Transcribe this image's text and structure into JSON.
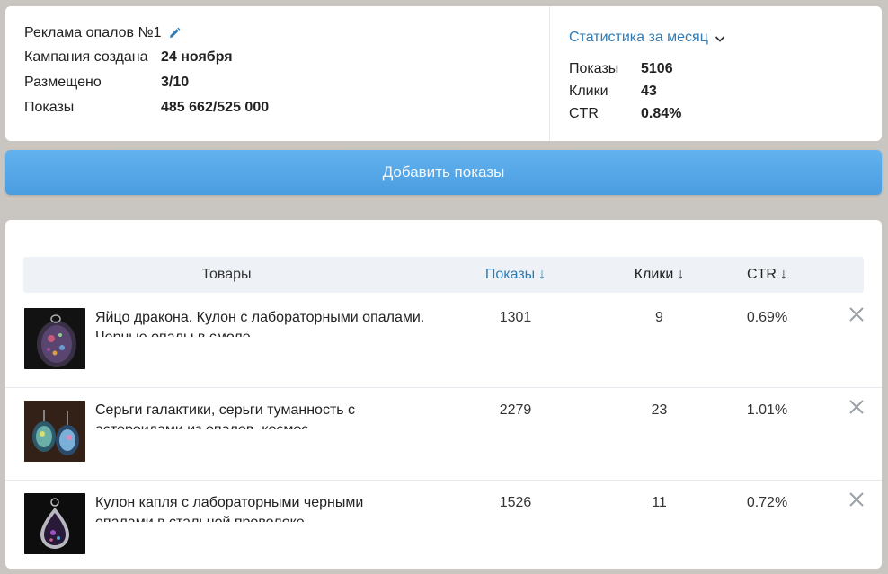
{
  "campaign": {
    "title": "Реклама опалов №1",
    "created_label": "Кампания создана",
    "created_value": "24 ноября",
    "placed_label": "Размещено",
    "placed_value": "3/10",
    "shows_label": "Показы",
    "shows_value": "485 662/525 000"
  },
  "monthly_stats": {
    "toggle_label": "Статистика за месяц",
    "shows_label": "Показы",
    "shows_value": "5106",
    "clicks_label": "Клики",
    "clicks_value": "43",
    "ctr_label": "CTR",
    "ctr_value": "0.84%"
  },
  "add_button_label": "Добавить показы",
  "table": {
    "headers": {
      "products": "Товары",
      "shows": "Показы",
      "clicks": "Клики",
      "ctr": "CTR",
      "sort_arrow": "↓"
    },
    "rows": [
      {
        "title_line1": "Яйцо дракона. Кулон с лабораторными опалами.",
        "title_line2": "Черные опалы в смоле",
        "shows": "1301",
        "clicks": "9",
        "ctr": "0.69%"
      },
      {
        "title_line1": "Серьги галактики, серьги туманность с",
        "title_line2": "астероидами из опалов, космос",
        "shows": "2279",
        "clicks": "23",
        "ctr": "1.01%"
      },
      {
        "title_line1": "Кулон капля с лабораторными черными",
        "title_line2": "опалами в стальной проволоке",
        "shows": "1526",
        "clicks": "11",
        "ctr": "0.72%"
      }
    ]
  },
  "colors": {
    "accent": "#2f7bb5",
    "button": "#4a9de0",
    "background": "#c9c6c2",
    "header_bg": "#eef2f6"
  },
  "icons": {
    "edit": "pencil-icon",
    "toggle": "chevron-down-icon",
    "remove": "close-icon"
  }
}
